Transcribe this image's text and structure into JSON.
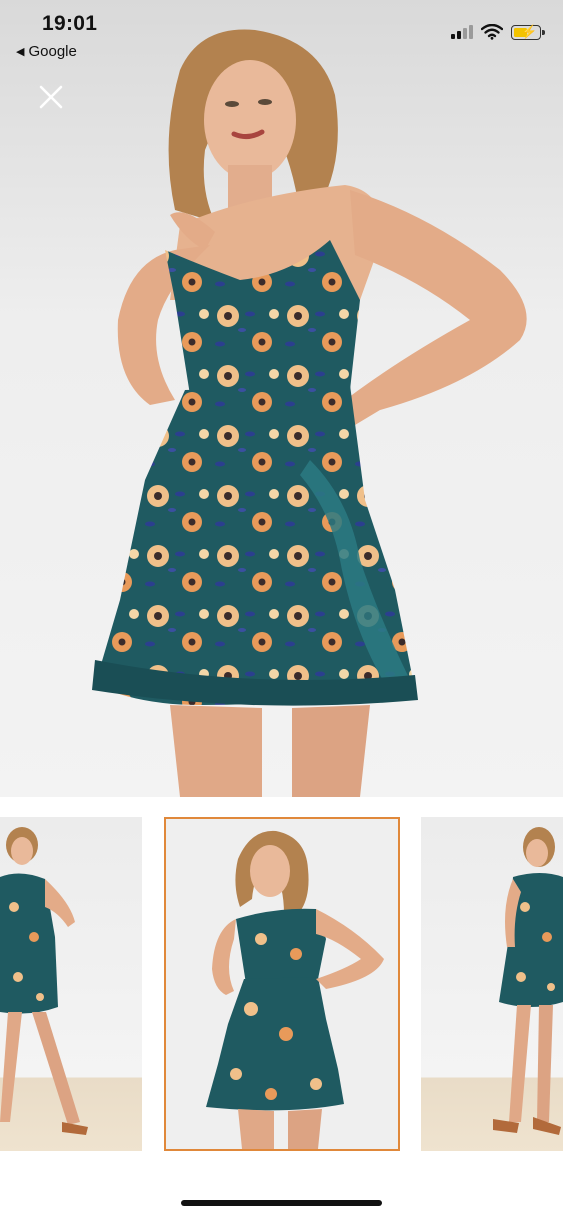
{
  "status_bar": {
    "time": "19:01",
    "back_label": "Google",
    "battery_color": "#f2c300"
  },
  "viewer": {
    "close_icon": "close-icon",
    "product": "floral-print-ruffle-mini-dress",
    "dress_color": "#1f5a61",
    "thumbnails": [
      {
        "name": "thumbnail-full-body-front"
      },
      {
        "name": "thumbnail-three-quarter",
        "selected": true
      },
      {
        "name": "thumbnail-full-body-side"
      }
    ],
    "selected_border_color": "#e0883a"
  }
}
